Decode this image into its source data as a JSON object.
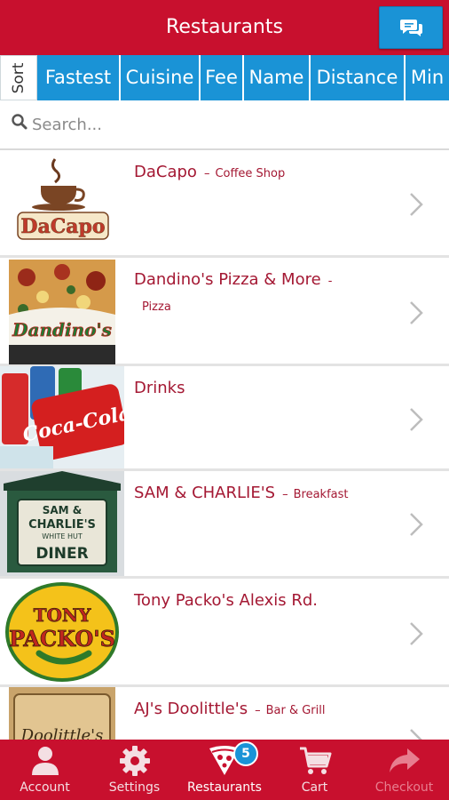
{
  "header": {
    "title": "Restaurants",
    "chat_icon": "chat-bubbles-icon"
  },
  "sort": {
    "label": "Sort",
    "options": [
      "Fastest",
      "Cuisine",
      "Fee",
      "Name",
      "Distance",
      "Min"
    ]
  },
  "search": {
    "placeholder": "Search...",
    "value": ""
  },
  "restaurants": [
    {
      "name": "DaCapo",
      "separator": "–",
      "cuisine": "Coffee Shop",
      "logo": "dacapo-coffee-logo"
    },
    {
      "name": "Dandino's Pizza & More",
      "separator": "-",
      "cuisine": "Pizza",
      "logo": "dandinos-pizza-photo"
    },
    {
      "name": "Drinks",
      "separator": "",
      "cuisine": "",
      "logo": "coca-cola-cans-photo"
    },
    {
      "name": "SAM & CHARLIE'S",
      "separator": "–",
      "cuisine": "Breakfast",
      "logo": "sam-charlies-diner-sign"
    },
    {
      "name": "Tony Packo's Alexis Rd.",
      "separator": "",
      "cuisine": "",
      "logo": "tony-packos-logo"
    },
    {
      "name": "AJ's Doolittle's",
      "separator": "–",
      "cuisine": "Bar & Grill",
      "logo": "ajs-doolittles-sign"
    }
  ],
  "logo_text": {
    "dacapo": "DaCapo",
    "dandino": "Dandino's",
    "coke": "Coca-Cola",
    "sam_line1": "SAM &",
    "sam_line2": "CHARLIE'S",
    "sam_line3": "WHITE HUT",
    "sam_line4": "DINER",
    "tony_line1": "TONY",
    "tony_line2": "PACKO'S",
    "aj": "Doolittle's"
  },
  "bottom_nav": {
    "items": [
      {
        "label": "Account",
        "icon": "person-icon"
      },
      {
        "label": "Settings",
        "icon": "gear-icon"
      },
      {
        "label": "Restaurants",
        "icon": "pizza-slice-icon"
      },
      {
        "label": "Cart",
        "icon": "cart-icon"
      },
      {
        "label": "Checkout",
        "icon": "share-arrow-icon"
      }
    ],
    "badge_count": "5",
    "active": "Restaurants",
    "disabled": "Checkout"
  },
  "colors": {
    "brand_red": "#c8102e",
    "accent_blue": "#1a93d6",
    "name_text": "#a41833"
  }
}
